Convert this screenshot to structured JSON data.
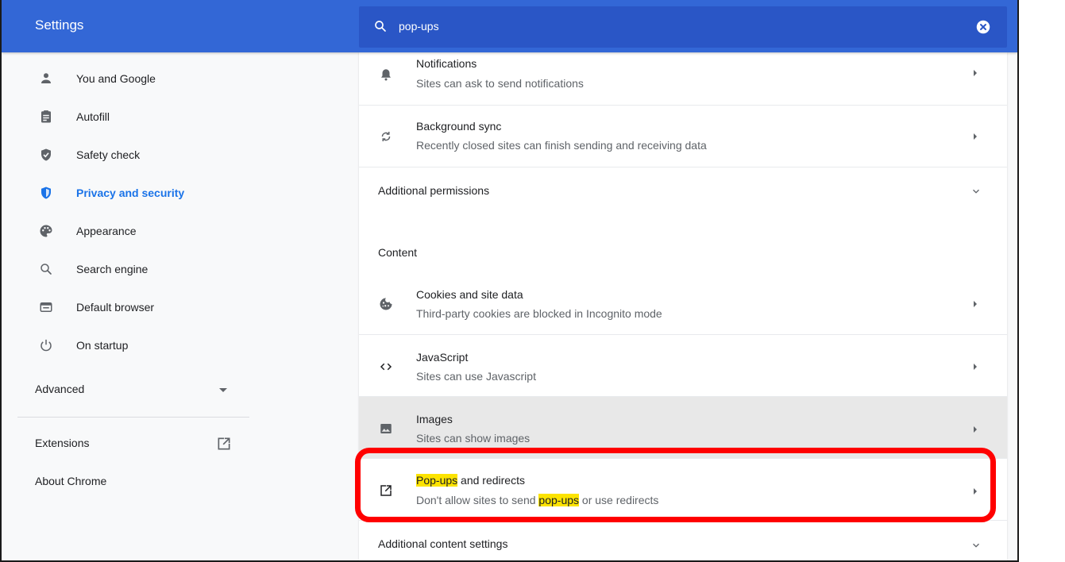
{
  "header": {
    "title": "Settings",
    "search_value": "pop-ups"
  },
  "sidebar": {
    "items": [
      {
        "label": "You and Google",
        "icon": "person-icon"
      },
      {
        "label": "Autofill",
        "icon": "clipboard-icon"
      },
      {
        "label": "Safety check",
        "icon": "shield-check-icon"
      },
      {
        "label": "Privacy and security",
        "icon": "shield-icon",
        "active": true
      },
      {
        "label": "Appearance",
        "icon": "palette-icon"
      },
      {
        "label": "Search engine",
        "icon": "search-icon"
      },
      {
        "label": "Default browser",
        "icon": "browser-icon"
      },
      {
        "label": "On startup",
        "icon": "power-icon"
      }
    ],
    "advanced_label": "Advanced",
    "extensions_label": "Extensions",
    "about_label": "About Chrome"
  },
  "main": {
    "notifications": {
      "title": "Notifications",
      "subtitle": "Sites can ask to send notifications"
    },
    "background_sync": {
      "title": "Background sync",
      "subtitle": "Recently closed sites can finish sending and receiving data"
    },
    "additional_permissions": "Additional permissions",
    "content_heading": "Content",
    "cookies": {
      "title": "Cookies and site data",
      "subtitle": "Third-party cookies are blocked in Incognito mode"
    },
    "javascript": {
      "title": "JavaScript",
      "subtitle": "Sites can use Javascript"
    },
    "images": {
      "title": "Images",
      "subtitle": "Sites can show images"
    },
    "popups": {
      "title_highlight": "Pop-ups",
      "title_rest": " and redirects",
      "subtitle_pre": "Don't allow sites to send ",
      "subtitle_highlight": "pop-ups",
      "subtitle_post": " or use redirects"
    },
    "additional_content": "Additional content settings"
  },
  "colors": {
    "header_blue": "#3367d6",
    "search_blue": "#2a56c6",
    "active_blue": "#1a73e8",
    "highlight_yellow": "#fce300",
    "annotation_red": "#ff0000"
  }
}
